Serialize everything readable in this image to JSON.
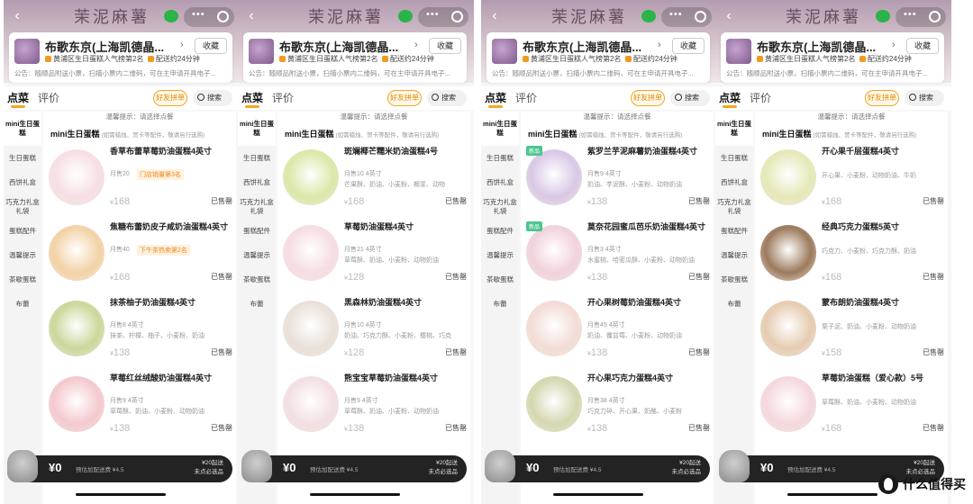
{
  "shop": {
    "banner_title": "茉泥麻薯",
    "name": "布歌东京(上海凯德晶...",
    "arrow": "›",
    "fav_label": "收藏",
    "tag_rank": "黄浦区生日蛋糕人气榜第2名",
    "tag_delivery": "配送约24分钟",
    "notice": "公告：随顺品附送小票，扫描小票内二维码，可在主申请开具电子..."
  },
  "tabs": {
    "order": "点菜",
    "review": "评价",
    "group": "好友拼单",
    "search": "搜索"
  },
  "side_categories": [
    "mini生日蛋糕",
    "生日蛋糕",
    "西饼礼盒",
    "巧克力礼盒礼袋",
    "蛋糕配件",
    "温馨提示",
    "茶歇蛋糕",
    "布蕾"
  ],
  "tip": "温馨提示：请选择点餐",
  "category": {
    "title": "mini生日蛋糕",
    "note": "(如需蜡烛、贺卡等配件，敬请另行选购)"
  },
  "sold_label": "已售罄",
  "cart": {
    "total": "¥0",
    "delivery": "预估加配送费 ¥4.5",
    "min_line1": "¥20起送",
    "min_line2": "未点必选品"
  },
  "screens": [
    {
      "items": [
        {
          "name": "香草布蕾草莓奶油蛋糕4英寸",
          "sub": "月售20",
          "promo": "门店销量第3名",
          "price": "168",
          "img": "#f7dfe4"
        },
        {
          "name": "焦糖布蕾奶皮子咸奶油蛋糕4英寸",
          "sub": "月售40",
          "promo": "下午茶热卖第2名",
          "price": "168",
          "img": "#f3d2a6"
        },
        {
          "name": "抹茶柚子奶油蛋糕4英寸",
          "sub": "月售8  4英寸",
          "sub2": "抹茶、柠檬、柚子、小麦粉、奶油",
          "price": "138",
          "img": "#c9d89a"
        },
        {
          "name": "草莓红丝绒酸奶油蛋糕4英寸",
          "sub": "月售9  4英寸",
          "sub2": "草莓酥、奶油、小麦粉、动物奶油",
          "price": "138",
          "img": "#f4c9cf"
        }
      ]
    },
    {
      "items": [
        {
          "name": "斑斓椰芒糯米奶油蛋糕4号",
          "sub": "月售10  4英寸",
          "sub2": "芒果酥、奶油、小麦粉、椰浆、动物",
          "price": "168",
          "img": "#d9e9a8"
        },
        {
          "name": "草莓奶油蛋糕4英寸",
          "sub": "月售21  4英寸",
          "sub2": "草莓酥、奶油、小麦粉、动物奶油",
          "price": "128",
          "img": "#f6dde2"
        },
        {
          "name": "黑森林奶油蛋糕4英寸",
          "sub": "月售10  4英寸",
          "sub2": "奶油、巧克力酥、小麦粉、樱桃、巧克",
          "price": "128",
          "img": "#e9e1d9"
        },
        {
          "name": "熊宝宝草莓奶油蛋糕4英寸",
          "sub": "月售9  4英寸",
          "sub2": "草莓酥、奶油、小麦粉、动物奶油",
          "price": "138",
          "img": "#f3dfe3"
        }
      ]
    },
    {
      "items": [
        {
          "name": "紫罗兰芋泥麻薯奶油蛋糕4英寸",
          "sub": "月售9  4英寸",
          "sub2": "奶油、芋泥酥、小麦粉、动物奶油",
          "price": "138",
          "img": "#d8c8e6",
          "badge": "新品"
        },
        {
          "name": "莫奈花园蜜瓜芭乐奶油蛋糕4英寸",
          "sub": "月售3  4英寸",
          "sub2": "水蜜桃、哈密瓜酥、小麦粉、动物奶油",
          "price": "138",
          "img": "#f1d2dc",
          "badge": "新品"
        },
        {
          "name": "开心果树莓奶油蛋糕4英寸",
          "sub": "月售45  4英寸",
          "sub2": "奶油、覆盆莓、小麦粉、动物奶油",
          "price": "138",
          "img": "#f3dcd6"
        },
        {
          "name": "开心果巧克力蛋糕4英寸",
          "sub": "月售38  4英寸",
          "sub2": "巧克力碎、开心果、奶酪、小麦粉",
          "price": "138",
          "img": "#d5d7b0"
        }
      ]
    },
    {
      "items": [
        {
          "name": "开心果千层蛋糕4英寸",
          "sub": "",
          "sub2": "开心果、小麦粉、动物奶油、牛奶",
          "price": "168",
          "img": "#e6e8b8"
        },
        {
          "name": "经典巧克力蛋糕5英寸",
          "sub": "",
          "sub2": "巧克力、小麦粉、巧克力酥、奶油",
          "price": "168",
          "img": "#9c7a5c"
        },
        {
          "name": "蒙布朗奶油蛋糕4英寸",
          "sub": "",
          "sub2": "栗子泥、奶油、小麦粉、动物奶油",
          "price": "158",
          "img": "#e5ccb1"
        },
        {
          "name": "草莓奶油蛋糕（爱心款）5号",
          "sub": "",
          "sub2": "草莓酥、奶油、小麦粉、动物奶油",
          "price": "168",
          "img": "#f5d8dc"
        }
      ]
    }
  ],
  "watermark": {
    "text": "什么值得买"
  }
}
